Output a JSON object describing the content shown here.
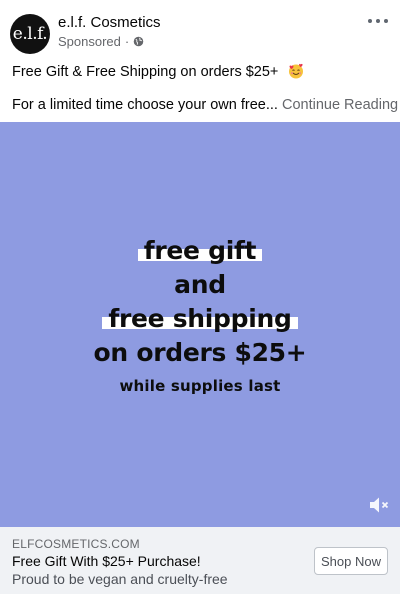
{
  "post": {
    "page_name": "e.l.f. Cosmetics",
    "avatar_text": "e.l.f.",
    "sponsored": "Sponsored",
    "separator": "·",
    "caption_line1": "Free Gift & Free Shipping on orders $25+",
    "caption_line2": "For a limited time choose your own free...",
    "continue_reading": "Continue Reading"
  },
  "creative": {
    "background": "#8e9be1",
    "line1": "free gift",
    "line2": "and",
    "line3": "free shipping",
    "line4": "on orders $25+",
    "line5": "while supplies last"
  },
  "link": {
    "domain": "ELFCOSMETICS.COM",
    "title": "Free Gift With $25+ Purchase!",
    "description": "Proud to be vegan and cruelty-free",
    "cta": "Shop Now"
  },
  "icons": {
    "more": "more-options-icon",
    "audience": "globe-icon",
    "emoji": "smiling-face-with-hearts-icon",
    "mute": "speaker-muted-icon"
  }
}
